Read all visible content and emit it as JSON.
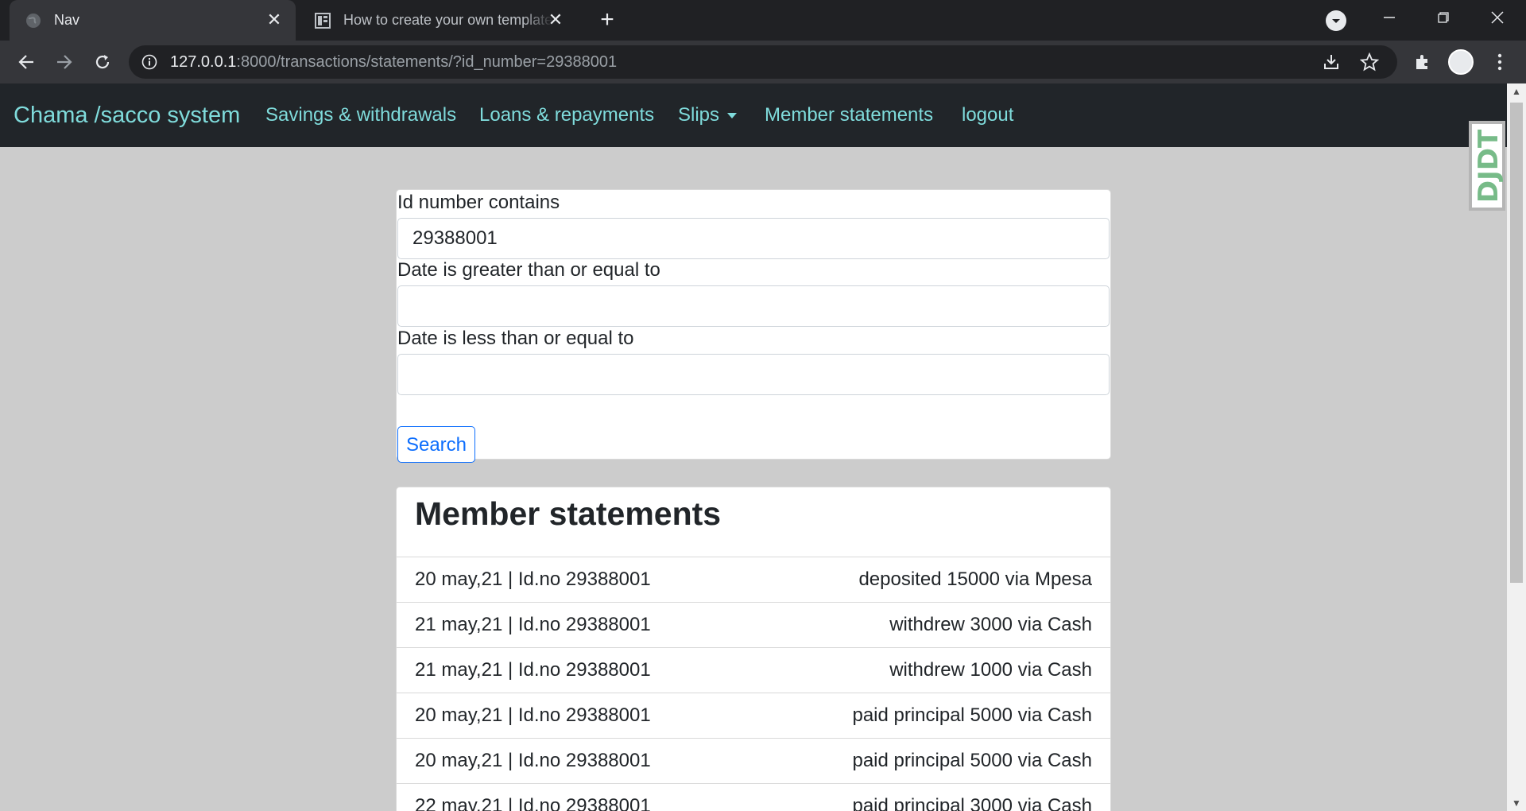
{
  "browser": {
    "tabs": [
      {
        "title": "Nav",
        "active": true,
        "icon": "globe-icon"
      },
      {
        "title": "How to create your own template",
        "active": false,
        "icon": "document-icon"
      }
    ],
    "url": {
      "host": "127.0.0.1",
      "rest": ":8000/transactions/statements/?id_number=29388001"
    }
  },
  "navbar": {
    "brand": "Chama /sacco system",
    "links": [
      {
        "label": "Savings & withdrawals"
      },
      {
        "label": "Loans & repayments"
      },
      {
        "label": "Slips",
        "dropdown": true
      },
      {
        "label": "Member statements"
      },
      {
        "label": "logout"
      }
    ]
  },
  "filters": {
    "id_label": "Id number contains",
    "id_value": "29388001",
    "date_gte_label": "Date is greater than or equal to",
    "date_gte_value": "",
    "date_lte_label": "Date is less than or equal to",
    "date_lte_value": "",
    "search_label": "Search"
  },
  "statements": {
    "title": "Member statements",
    "rows": [
      {
        "left": "20 may,21 | Id.no 29388001",
        "right": "deposited 15000 via Mpesa"
      },
      {
        "left": "21 may,21 | Id.no 29388001",
        "right": "withdrew 3000 via Cash"
      },
      {
        "left": "21 may,21 | Id.no 29388001",
        "right": "withdrew 1000 via Cash"
      },
      {
        "left": "20 may,21 | Id.no 29388001",
        "right": "paid principal 5000 via Cash"
      },
      {
        "left": "20 may,21 | Id.no 29388001",
        "right": "paid principal 5000 via Cash"
      },
      {
        "left": "22 may,21 | Id.no 29388001",
        "right": "paid principal 3000 via Cash"
      }
    ]
  },
  "toolbar_widget": {
    "label": "DJDT"
  },
  "colors": {
    "navbar_bg": "#212529",
    "link": "#7fdbdb",
    "page_bg": "#cccccc",
    "primary": "#0d6efd"
  }
}
